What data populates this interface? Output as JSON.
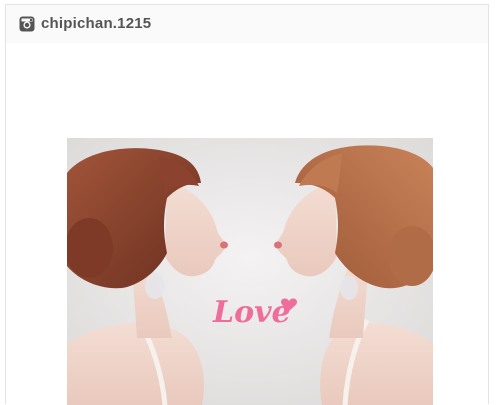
{
  "post": {
    "username": "chipichan.1215",
    "platform_icon": "instagram-icon",
    "photo": {
      "caption_overlay": "Love"
    }
  },
  "colors": {
    "header_bg": "#fafafa",
    "username": "#555555",
    "love_text": "#ef6d9b"
  }
}
